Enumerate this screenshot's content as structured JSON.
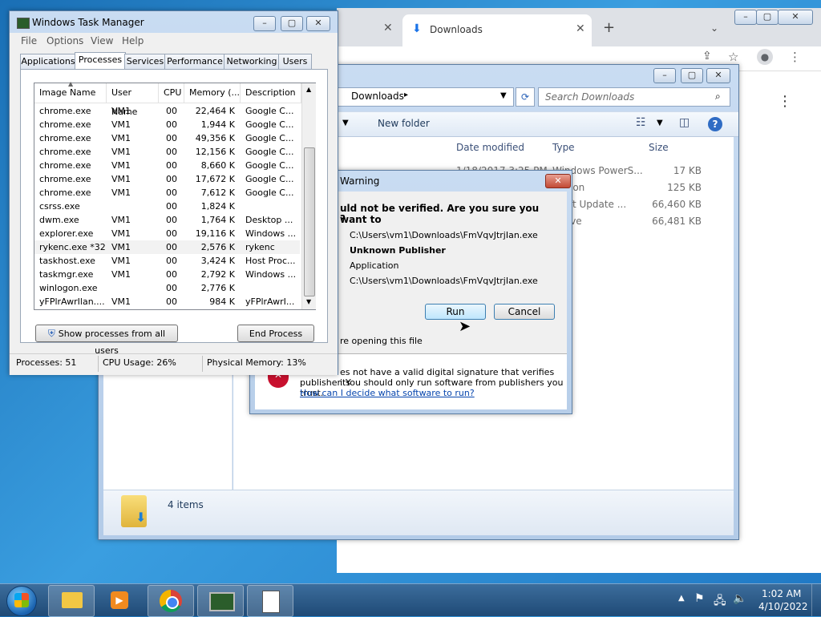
{
  "chrome": {
    "tab_downloads": "Downloads"
  },
  "explorer": {
    "breadcrumb": "Downloads",
    "search_placeholder": "Search Downloads",
    "toolbar_new_folder": "New folder",
    "col_date": "Date modified",
    "col_type": "Type",
    "col_size": "Size",
    "rows": [
      {
        "date": "1/18/2017 3:25 PM",
        "type": "Windows PowerS...",
        "size": "17 KB"
      },
      {
        "date": "",
        "type": "ication",
        "size": "125 KB"
      },
      {
        "date": "",
        "type": "osoft Update ...",
        "size": "66,460 KB"
      },
      {
        "date": "",
        "type": "rchive",
        "size": "66,481 KB"
      }
    ],
    "status_items": "4 items"
  },
  "warning": {
    "title": "Warning",
    "question_1": "uld not be verified.  Are you sure you want to",
    "question_2": "?",
    "name_value": "C:\\Users\\vm1\\Downloads\\FmVqvJtrjIan.exe",
    "publisher_value": "Unknown Publisher",
    "type_value": "Application",
    "from_value": "C:\\Users\\vm1\\Downloads\\FmVqvJtrjIan.exe",
    "run_label": "Run",
    "cancel_label": "Cancel",
    "checkbox_text": "re opening this file",
    "footer_line1": "es not have a valid digital signature that verifies its",
    "footer_line2": "publisher.  You should only run software from publishers you trust.",
    "footer_link": "How can I decide what software to run?"
  },
  "taskmgr": {
    "title": "Windows Task Manager",
    "menu": [
      "File",
      "Options",
      "View",
      "Help"
    ],
    "tabs": [
      "Applications",
      "Processes",
      "Services",
      "Performance",
      "Networking",
      "Users"
    ],
    "columns": [
      "Image Name",
      "User Name",
      "CPU",
      "Memory (...",
      "Description"
    ],
    "rows": [
      {
        "name": "chrome.exe",
        "user": "VM1",
        "cpu": "00",
        "mem": "22,464 K",
        "desc": "Google C..."
      },
      {
        "name": "chrome.exe",
        "user": "VM1",
        "cpu": "00",
        "mem": "1,944 K",
        "desc": "Google C..."
      },
      {
        "name": "chrome.exe",
        "user": "VM1",
        "cpu": "00",
        "mem": "49,356 K",
        "desc": "Google C..."
      },
      {
        "name": "chrome.exe",
        "user": "VM1",
        "cpu": "00",
        "mem": "12,156 K",
        "desc": "Google C..."
      },
      {
        "name": "chrome.exe",
        "user": "VM1",
        "cpu": "00",
        "mem": "8,660 K",
        "desc": "Google C..."
      },
      {
        "name": "chrome.exe",
        "user": "VM1",
        "cpu": "00",
        "mem": "17,672 K",
        "desc": "Google C..."
      },
      {
        "name": "chrome.exe",
        "user": "VM1",
        "cpu": "00",
        "mem": "7,612 K",
        "desc": "Google C..."
      },
      {
        "name": "csrss.exe",
        "user": "",
        "cpu": "00",
        "mem": "1,824 K",
        "desc": ""
      },
      {
        "name": "dwm.exe",
        "user": "VM1",
        "cpu": "00",
        "mem": "1,764 K",
        "desc": "Desktop ..."
      },
      {
        "name": "explorer.exe",
        "user": "VM1",
        "cpu": "00",
        "mem": "19,116 K",
        "desc": "Windows ..."
      },
      {
        "name": "rykenc.exe *32",
        "user": "VM1",
        "cpu": "00",
        "mem": "2,576 K",
        "desc": "rykenc"
      },
      {
        "name": "taskhost.exe",
        "user": "VM1",
        "cpu": "00",
        "mem": "3,424 K",
        "desc": "Host Proc..."
      },
      {
        "name": "taskmgr.exe",
        "user": "VM1",
        "cpu": "00",
        "mem": "2,792 K",
        "desc": "Windows ..."
      },
      {
        "name": "winlogon.exe",
        "user": "",
        "cpu": "00",
        "mem": "2,776 K",
        "desc": ""
      },
      {
        "name": "yFPlrAwrIlan....",
        "user": "VM1",
        "cpu": "00",
        "mem": "984 K",
        "desc": "yFPlrAwrI..."
      }
    ],
    "show_all_label": "Show processes from all users",
    "end_process_label": "End Process",
    "status_processes": "Processes: 51",
    "status_cpu": "CPU Usage: 26%",
    "status_memory": "Physical Memory: 13%"
  },
  "taskbar": {
    "time": "1:02 AM",
    "date": "4/10/2022"
  },
  "colors": {
    "accent": "#3a9ee0",
    "link": "#0645ad",
    "danger": "#c8102e"
  }
}
